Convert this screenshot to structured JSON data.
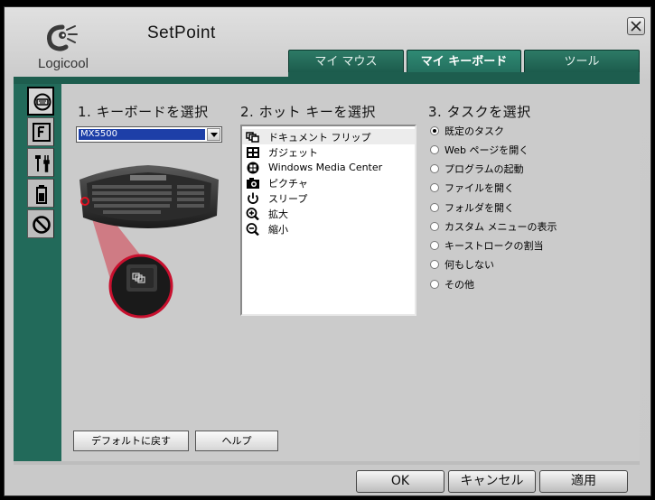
{
  "app": {
    "logo_text": "Logicool",
    "title": "SetPoint"
  },
  "tabs": [
    {
      "label": "マイ マウス",
      "active": false
    },
    {
      "label": "マイ キーボード",
      "active": true
    },
    {
      "label": "ツール",
      "active": false
    }
  ],
  "sidebar": [
    {
      "icon": "keyboard-icon",
      "active": true
    },
    {
      "icon": "f-key-icon",
      "active": false
    },
    {
      "icon": "tools-icon",
      "active": false
    },
    {
      "icon": "battery-icon",
      "active": false
    },
    {
      "icon": "prohibit-icon",
      "active": false
    }
  ],
  "section1": {
    "title": "1. キーボードを選択",
    "keyboard_value": "MX5500"
  },
  "section2": {
    "title": "2. ホット キーを選択",
    "hotkeys": [
      {
        "label": "ドキュメント フリップ",
        "icon": "document-flip-icon",
        "selected": true
      },
      {
        "label": "ガジェット",
        "icon": "gadget-icon",
        "selected": false
      },
      {
        "label": "Windows Media Center",
        "icon": "windows-media-center-icon",
        "selected": false
      },
      {
        "label": "ピクチャ",
        "icon": "camera-icon",
        "selected": false
      },
      {
        "label": "スリープ",
        "icon": "power-icon",
        "selected": false
      },
      {
        "label": "拡大",
        "icon": "zoom-in-icon",
        "selected": false
      },
      {
        "label": "縮小",
        "icon": "zoom-out-icon",
        "selected": false
      }
    ]
  },
  "section3": {
    "title": "3. タスクを選択",
    "tasks": [
      {
        "label": "既定のタスク",
        "checked": true
      },
      {
        "label": "Web ページを開く",
        "checked": false
      },
      {
        "label": "プログラムの起動",
        "checked": false
      },
      {
        "label": "ファイルを開く",
        "checked": false
      },
      {
        "label": "フォルダを開く",
        "checked": false
      },
      {
        "label": "カスタム メニューの表示",
        "checked": false
      },
      {
        "label": "キーストロークの割当",
        "checked": false
      },
      {
        "label": "何もしない",
        "checked": false
      },
      {
        "label": "その他",
        "checked": false
      }
    ]
  },
  "buttons": {
    "default_label": "デフォルトに戻す",
    "help_label": "ヘルプ",
    "ok_label": "OK",
    "cancel_label": "キャンセル",
    "apply_label": "適用"
  },
  "colors": {
    "accent_teal": "#226a5a",
    "tab_teal": "#1b5a4b",
    "selection_blue": "#1d3fa8",
    "highlight_red": "#c8102e"
  }
}
